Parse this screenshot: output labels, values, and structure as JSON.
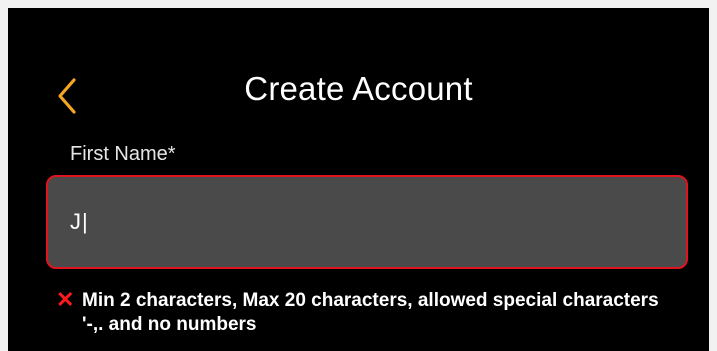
{
  "header": {
    "back_icon": "chevron-left-icon",
    "title": "Create Account"
  },
  "form": {
    "first_name": {
      "label": "First Name*",
      "value": "J",
      "state": "error",
      "caret": "|"
    },
    "error": {
      "icon": "x-mark-icon",
      "message": "Min 2 characters, Max 20 characters, allowed special characters '-,. and no numbers"
    }
  },
  "colors": {
    "background": "#000000",
    "accent": "#f5a623",
    "input_fill": "#4a4a4a",
    "error": "#e0141e",
    "text": "#ffffff"
  }
}
